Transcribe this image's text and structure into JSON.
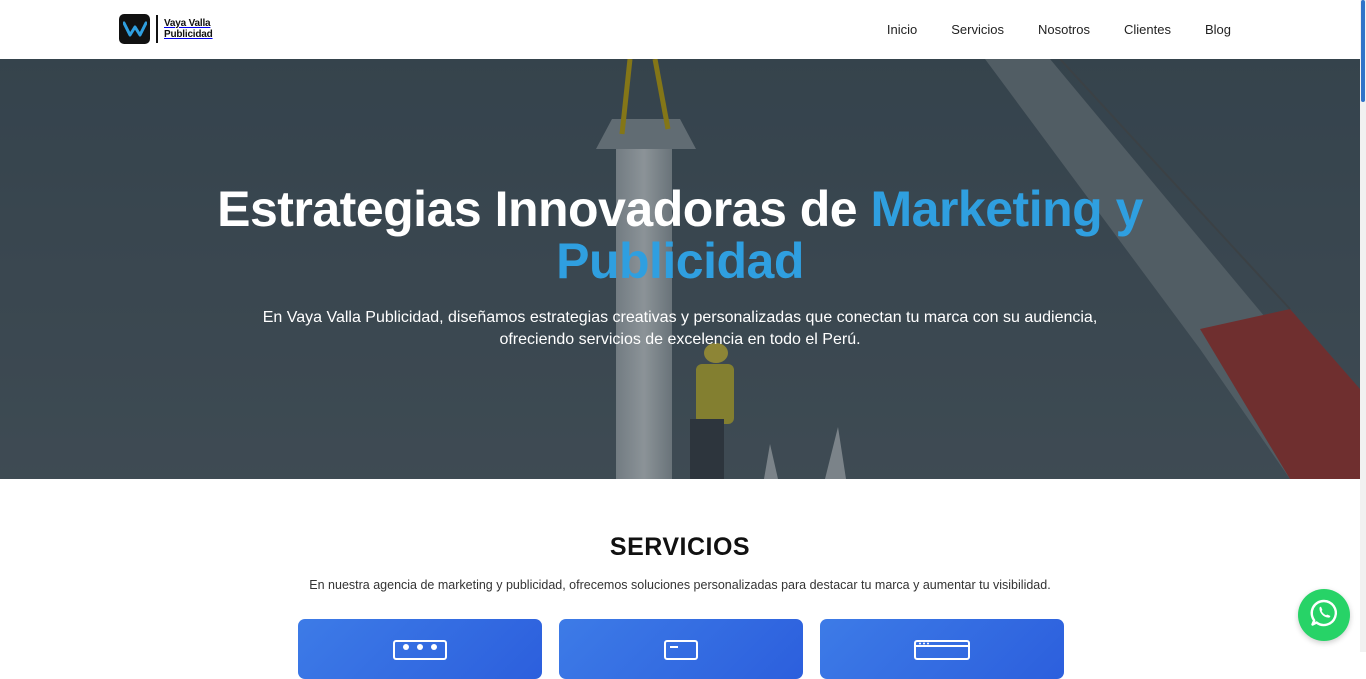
{
  "brand": {
    "name_line1": "Vaya Valla",
    "name_line2": "Publicidad"
  },
  "nav": {
    "items": [
      {
        "label": "Inicio"
      },
      {
        "label": "Servicios"
      },
      {
        "label": "Nosotros"
      },
      {
        "label": "Clientes"
      },
      {
        "label": "Blog"
      }
    ]
  },
  "hero": {
    "title_white": "Estrategias Innovadoras de ",
    "title_accent_1": "Marketing y",
    "title_accent_2": "Publicidad",
    "subtitle": "En Vaya Valla Publicidad, diseñamos estrategias creativas y personalizadas que conectan tu marca con su audiencia, ofreciendo servicios de excelencia en todo el Perú."
  },
  "services": {
    "title": "SERVICIOS",
    "subtitle": "En nuestra agencia de marketing y publicidad, ofrecemos soluciones personalizadas para destacar tu marca y aumentar tu visibilidad.",
    "cards": [
      {
        "icon": "billboard-icon"
      },
      {
        "icon": "monitor-icon"
      },
      {
        "icon": "browser-window-icon"
      }
    ]
  },
  "colors": {
    "accent": "#2f9fe0",
    "card_blue": "#3d7be7",
    "whatsapp": "#27d367"
  },
  "whatsapp": {
    "icon": "whatsapp-icon"
  }
}
